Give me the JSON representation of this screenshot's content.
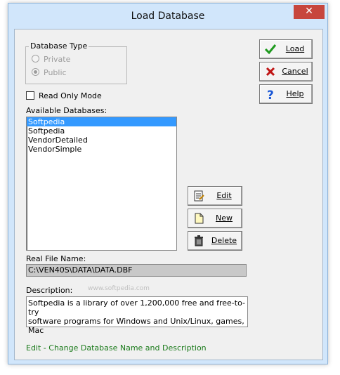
{
  "window": {
    "title": "Load Database",
    "close_symbol": "✕"
  },
  "database_type": {
    "legend": "Database Type",
    "options": [
      {
        "label": "Private",
        "checked": false
      },
      {
        "label": "Public",
        "checked": true
      }
    ]
  },
  "read_only": {
    "label": "Read Only Mode",
    "checked": false
  },
  "available": {
    "label": "Available Databases:",
    "items": [
      {
        "label": "Softpedia",
        "selected": true
      },
      {
        "label": "Softpedia",
        "selected": false
      },
      {
        "label": "VendorDetailed",
        "selected": false
      },
      {
        "label": "VendorSimple",
        "selected": false
      }
    ]
  },
  "buttons": {
    "load": "Load",
    "cancel": "Cancel",
    "help": "Help",
    "edit": "Edit",
    "new": "New",
    "delete": "Delete"
  },
  "file": {
    "label": "Real File Name:",
    "value": "C:\\VEN40S\\DATA\\DATA.DBF"
  },
  "description": {
    "label": "Description:",
    "line1": "Softpedia is a library of over 1,200,000 free and free-to-try",
    "line2": "software programs for Windows and Unix/Linux, games, Mac"
  },
  "watermark": "www.softpedia.com",
  "status": "Edit - Change Database Name and Description",
  "colors": {
    "selection": "#3399ff",
    "status_text": "#1a7a1a",
    "close_button": "#c7463d",
    "load_icon": "#1f9a1f",
    "cancel_icon": "#c01515",
    "help_icon": "#1a57d6"
  }
}
